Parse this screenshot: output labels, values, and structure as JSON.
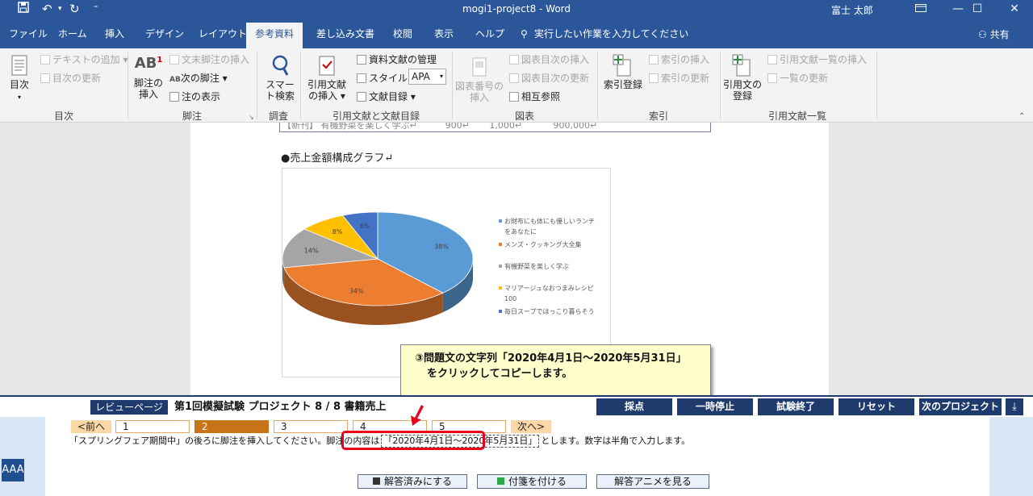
{
  "titlebar": {
    "doc_title": "mogi1-project8  -  Word",
    "user": "富士 太郎"
  },
  "tabs": [
    "ファイル",
    "ホーム",
    "挿入",
    "デザイン",
    "レイアウト",
    "参考資料",
    "差し込み文書",
    "校閲",
    "表示",
    "ヘルプ",
    "実行したい作業を入力してください"
  ],
  "share_label": "共有",
  "ribbon": {
    "toc": {
      "big": "目次",
      "add_text": "テキストの追加",
      "update": "目次の更新",
      "group": "目次"
    },
    "footnote": {
      "insert": "脚注の挿入",
      "endnote": "文末脚注の挿入",
      "next": "次の脚注",
      "show": "注の表示",
      "group": "脚注"
    },
    "research": {
      "smart": "スマート検索",
      "group": "調査"
    },
    "citation": {
      "insert": "引用文献の挿入",
      "manage": "資料文献の管理",
      "style_label": "スタイル:",
      "style_value": "APA",
      "bib": "文献目録",
      "group": "引用文献と文献目録"
    },
    "captions": {
      "insert": "図表番号の挿入",
      "tof": "図表目次の挿入",
      "update": "図表目次の更新",
      "cross": "相互参照",
      "group": "図表"
    },
    "index": {
      "mark": "索引登録",
      "insert": "索引の挿入",
      "update": "索引の更新",
      "group": "索引"
    },
    "toa": {
      "mark": "引用文の登録",
      "insert": "引用文献一覧の挿入",
      "update": "一覧の更新",
      "group": "引用文献一覧"
    }
  },
  "document": {
    "table_fragment": "【新刊】 有機野菜を楽しく学ぶ↵          900↵       1,000↵           900,000↵",
    "heading": "●売上金額構成グラフ↵"
  },
  "chart_data": {
    "type": "pie",
    "categories": [
      "お財布にも体にも優しいランチをあなたに",
      "メンズ・クッキング大全集",
      "有機野菜を楽しく学ぶ",
      "マリアージュなおつまみレシピ100",
      "毎日スープでほっこり暮らそう"
    ],
    "values": [
      38,
      34,
      14,
      8,
      6
    ],
    "labels": [
      "38%",
      "34%",
      "14%",
      "8%",
      "6%"
    ],
    "colors": [
      "#5b9bd5",
      "#ed7d31",
      "#a5a5a5",
      "#ffc000",
      "#4472c4"
    ],
    "legend_lines": [
      [
        "お財布にも体にも優しいランチ",
        "をあなたに"
      ],
      [
        "メンズ・クッキング大全集"
      ],
      [
        "有機野菜を楽しく学ぶ"
      ],
      [
        "マリアージュなおつまみレシピ",
        "100"
      ],
      [
        "毎日スープでほっこり暮らそう"
      ]
    ],
    "legend_position": "right",
    "style": "3d"
  },
  "tooltip": {
    "line1": "③問題文の文字列「2020年4月1日～2020年5月31日」",
    "line2": "をクリックしてコピーします。"
  },
  "statusbar": {
    "review": "レビューページ",
    "exam_title": "第1回模擬試験 プロジェクト 8 / 8 書籍売上",
    "buttons": {
      "score": "採点",
      "pause": "一時停止",
      "end": "試験終了",
      "reset": "リセット",
      "next_project": "次のプロジェクト"
    }
  },
  "question": {
    "prev": "<前へ",
    "next": "次へ>",
    "items": [
      "1",
      "2",
      "3",
      "4",
      "5"
    ],
    "current": "2",
    "text_before": "「スプリングフェア期間中」の後ろに脚注を挿入してください。脚注の内容は",
    "highlight": "「2020年4月1日～2020年5月31日」",
    "text_after": "とします。数字は半角で入力します。",
    "btn_answered": "解答済みにする",
    "btn_tag": "付箋を付ける",
    "btn_anime": "解答アニメを見る",
    "font_size": "AAA"
  }
}
